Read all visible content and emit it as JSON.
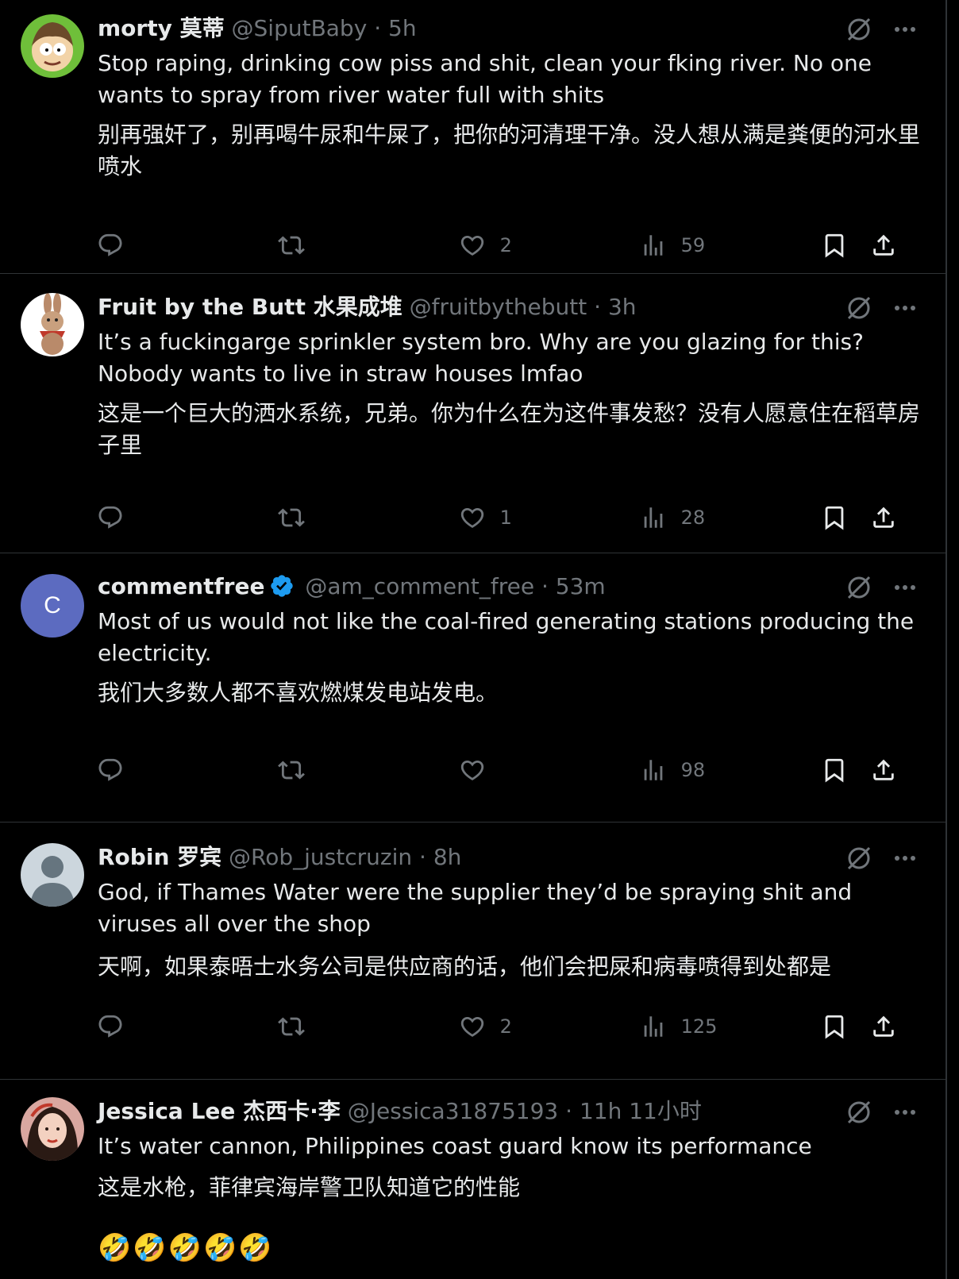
{
  "tweets": [
    {
      "name": "morty 莫蒂",
      "handle": "@SiputBaby",
      "dot": "·",
      "time": "5h",
      "verified": false,
      "avatar": "rick-and-morty-avatar",
      "text_en": "Stop raping, drinking cow piss and shit, clean your fking river. No one wants to spray from river water full with shits",
      "text_zh": "别再强奸了，别再喝牛尿和牛屎了，把你的河清理干净。没人想从满是粪便的河水里喷水",
      "likes": "2",
      "views": "59"
    },
    {
      "name": "Fruit by the Butt 水果成堆",
      "handle": "@fruitbythebutt",
      "dot": "·",
      "time": "3h",
      "verified": false,
      "avatar": "rabbit-avatar",
      "text_en": "It’s a fuckingarge sprinkler system bro. Why are you glazing for this? Nobody wants to live in straw houses lmfao",
      "text_zh": "这是一个巨大的洒水系统，兄弟。你为什么在为这件事发愁？没有人愿意住在稻草房子里",
      "likes": "1",
      "views": "28"
    },
    {
      "name": "commentfree",
      "handle": "@am_comment_free",
      "dot": "·",
      "time": "53m",
      "verified": true,
      "avatar": "letter-avatar",
      "avatar_letter": "C",
      "text_en": "Most of us would not like the coal-fired generating stations producing the electricity.",
      "text_zh": "我们大多数人都不喜欢燃煤发电站发电。",
      "likes": "",
      "views": "98"
    },
    {
      "name": "Robin 罗宾",
      "handle": "@Rob_justcruzin",
      "dot": "·",
      "time": "8h",
      "verified": false,
      "avatar": "default-person-avatar",
      "text_en": "God, if Thames Water were the supplier they’d be spraying shit and viruses all over the shop",
      "text_zh": "天啊，如果泰晤士水务公司是供应商的话，他们会把屎和病毒喷得到处都是",
      "likes": "2",
      "views": "125"
    },
    {
      "name": "Jessica Lee 杰西卡·李",
      "handle": "@Jessica31875193",
      "dot": "·",
      "time": "11h 11小时",
      "verified": false,
      "avatar": "woman-photo-avatar",
      "text_en": "It’s water cannon, Philippines coast guard know its performance",
      "text_zh": "这是水枪，菲律宾海岸警卫队知道它的性能",
      "emoji": "🤣🤣🤣🤣🤣"
    }
  ],
  "icons": {
    "reply": "reply-icon",
    "repost": "repost-icon",
    "like": "heart-icon",
    "views": "views-icon",
    "bookmark": "bookmark-icon",
    "share": "share-icon",
    "grok": "grok-icon",
    "more": "more-icon"
  },
  "colors": {
    "background": "#000000",
    "text": "#e7e9ea",
    "muted": "#71767b",
    "divider": "#2f3336",
    "verified": "#1d9bf0",
    "letter_avatar": "#5c6bc0"
  }
}
